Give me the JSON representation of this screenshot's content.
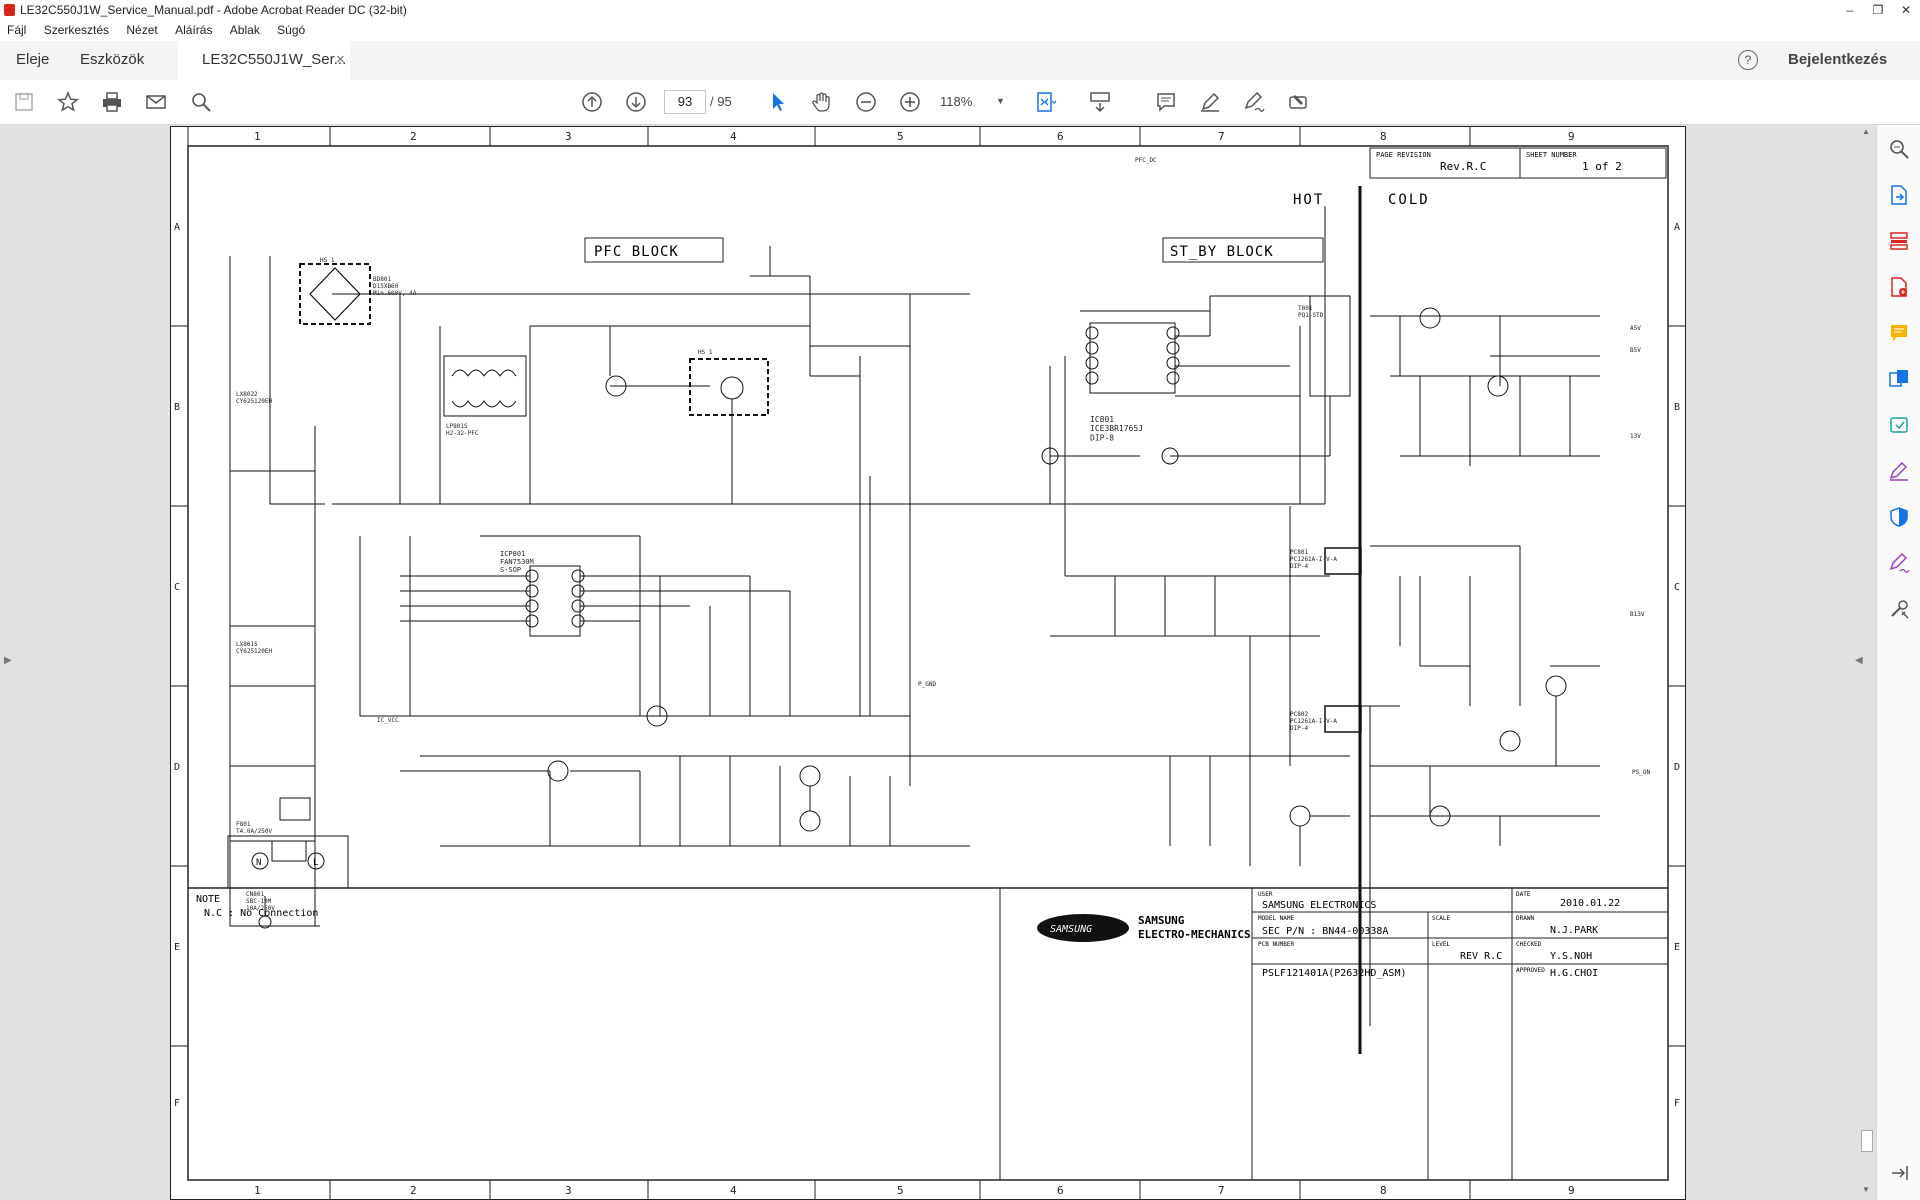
{
  "window": {
    "title": "LE32C550J1W_Service_Manual.pdf - Adobe Acrobat Reader DC (32-bit)",
    "controls": [
      "–",
      "❐",
      "✕"
    ]
  },
  "menu": [
    "Fájl",
    "Szerkesztés",
    "Nézet",
    "Aláírás",
    "Ablak",
    "Súgó"
  ],
  "tabs": {
    "home": "Eleje",
    "tools": "Eszközök",
    "document": "LE32C550J1W_Ser...",
    "close": "×",
    "signin": "Bejelentkezés",
    "help": "?"
  },
  "toolbar": {
    "current_page": "93",
    "total_pages": "/ 95",
    "zoom": "118%"
  },
  "schematic": {
    "columns": [
      "1",
      "2",
      "3",
      "4",
      "5",
      "6",
      "7",
      "8",
      "9"
    ],
    "rows": [
      "A",
      "B",
      "C",
      "D",
      "E",
      "F"
    ],
    "blocks": {
      "pfc": "PFC BLOCK",
      "standby": "ST_BY BLOCK",
      "hot": "HOT",
      "cold": "COLD"
    },
    "page_revision_label": "PAGE REVISION",
    "page_revision": "Rev.R.C",
    "sheet_number_label": "SHEET NUMBER",
    "sheet_number": "1 of 2",
    "note_title": "NOTE",
    "note_text": "N.C : No Connection",
    "title_block": {
      "user_label": "USER",
      "user": "SAMSUNG ELECTRONICS",
      "date_label": "DATE",
      "date": "2010.01.22",
      "model_label": "MODEL NAME",
      "model": "SEC P/N : BN44-00338A",
      "scale_label": "SCALE",
      "drawn_label": "DRAWN",
      "drawn": "N.J.PARK",
      "checked_label": "CHECKED",
      "checked": "Y.S.NOH",
      "pcb_label": "PCB NUMBER",
      "pcb": "PSLF121401A(P2632HD_ASM)",
      "level_label": "LEVEL",
      "level": "REV R.C",
      "approved_label": "APPROVED",
      "approved": "H.G.CHOI",
      "logo": "SAMSUNG",
      "company_line1": "SAMSUNG",
      "company_line2": "ELECTRO-MECHANICS"
    },
    "components": {
      "hs1a": "HS 1",
      "hs1b": "HS 1",
      "bd801": "BD801\nD15XB60\nMin.600V, 4A",
      "lf801": "LP801S\nH2-32-PFC",
      "lf802": "LX8022\nCY625120EH",
      "lf801b": "LX801S\nCY625120EH",
      "ic801": "IC801\nICE3BR1765J\nDIP-8",
      "icp801": "ICP801\nFAN7530M\nS-SOP",
      "pc801": "PC801\nPC1261A-I-V-A\nDIP-4",
      "pc802": "PC802\nPC1261A-I-V-A\nDIP-4",
      "t801": "T801\nPQ1-STD",
      "cn801": "CN801\nSBC-10M\n10A/250V",
      "fuse": "F801\nT4.0A/250V",
      "out_a5v": "A5V",
      "out_b5v": "B5V",
      "out_13v": "13V",
      "out_pfc": "PFC_DC",
      "out_pgnd": "P_GND",
      "out_icvcc": "IC_VCC",
      "out_pson": "PS_ON",
      "out_b13v": "B13V",
      "n_label": "N",
      "l_label": "L"
    }
  }
}
